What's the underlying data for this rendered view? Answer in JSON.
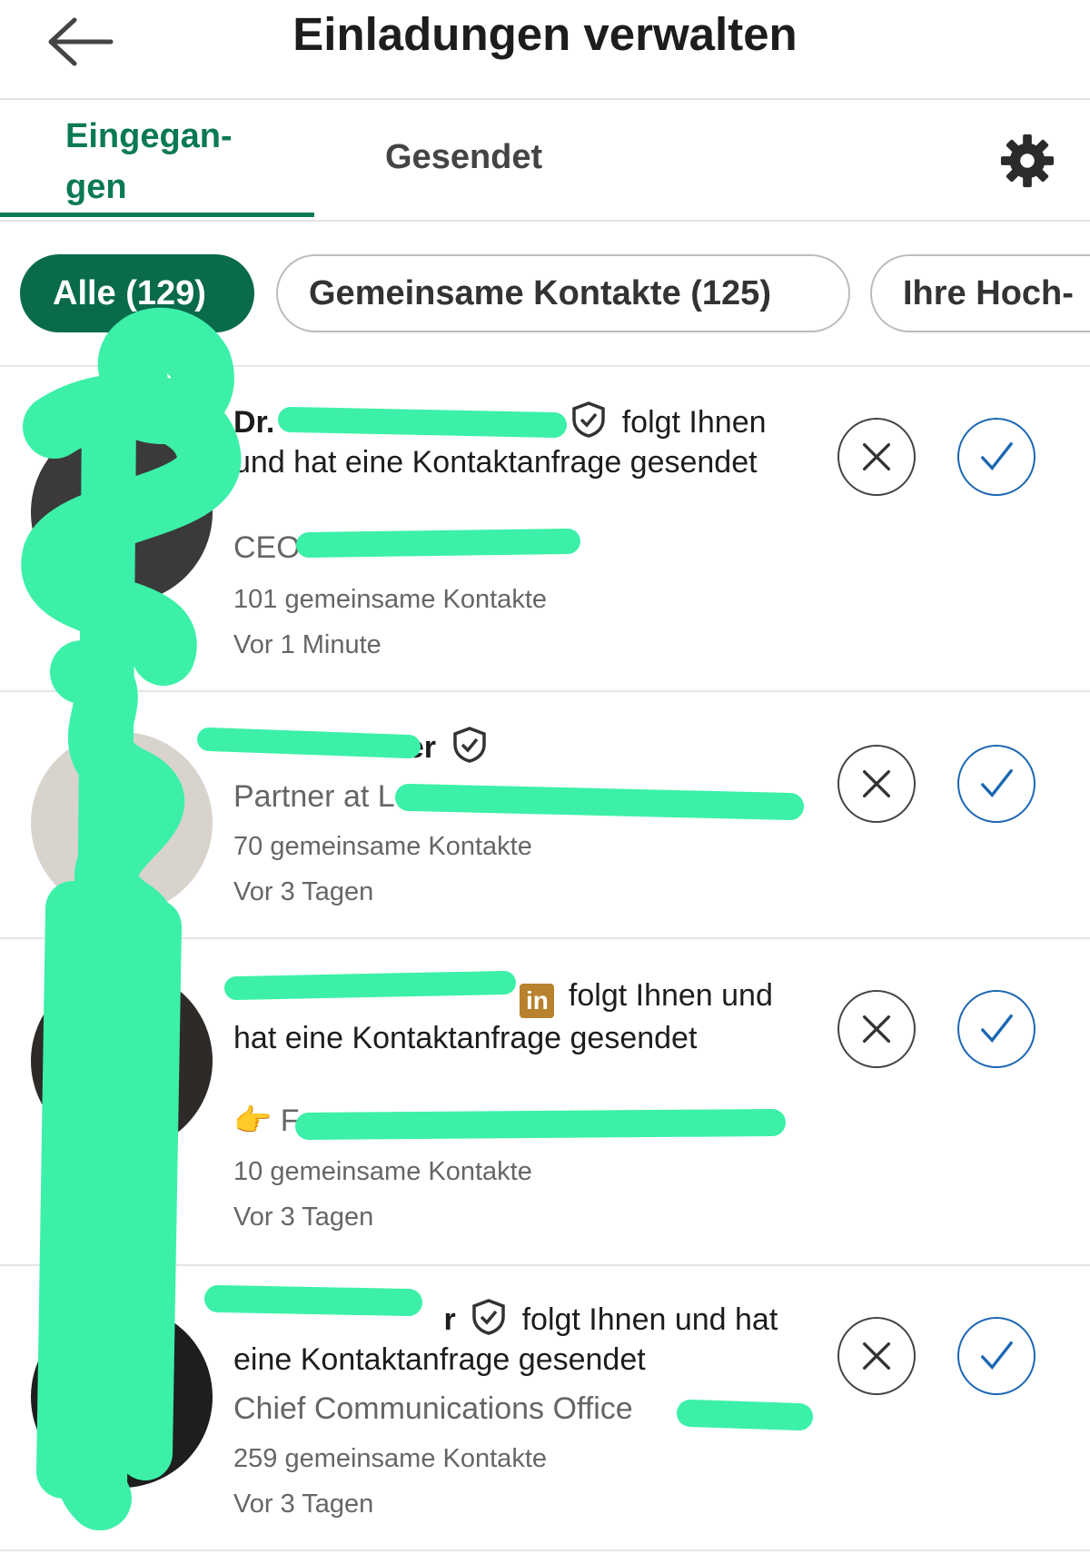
{
  "header": {
    "title": "Einladungen verwalten",
    "back_icon": "arrow-left-icon"
  },
  "tabs": {
    "received": "Eingegan-\ngen",
    "sent": "Gesendet",
    "settings_icon": "gear-icon"
  },
  "filters": [
    {
      "label": "Alle (129)",
      "active": true
    },
    {
      "label": "Gemeinsame Kontakte (125)",
      "active": false
    },
    {
      "label": "Ihre Hoch-",
      "active": false
    }
  ],
  "invitations": [
    {
      "name": "Dr.",
      "badge": "verified-shield-icon",
      "action_text": "folgt Ihnen und hat eine Kontaktanfrage gesendet",
      "headline": "CEO",
      "mutual": "101 gemeinsame Kontakte",
      "time": "Vor 1 Minute"
    },
    {
      "name": "ler",
      "badge": "verified-shield-icon",
      "action_text": "",
      "headline": "Partner at L",
      "mutual": "70 gemeinsame Kontakte",
      "time": "Vor 3 Tagen"
    },
    {
      "name": "",
      "badge": "linkedin-premium-icon",
      "badge_text": "in",
      "action_text": "folgt Ihnen und hat eine Kontaktanfrage gesendet",
      "headline": "👉 F",
      "mutual": "10 gemeinsame Kontakte",
      "time": "Vor 3 Tagen"
    },
    {
      "name": "r",
      "badge": "verified-shield-icon",
      "action_text": "folgt Ihnen und hat eine Kontaktanfrage gesendet",
      "headline": "Chief Communications Office",
      "mutual": "259 gemeinsame Kontakte",
      "time": "Vor 3 Tagen"
    }
  ],
  "colors": {
    "accent": "#0a7a53",
    "chip_active": "#0a6b4b",
    "accept": "#1b67b3",
    "redaction": "#3cf0a8"
  }
}
